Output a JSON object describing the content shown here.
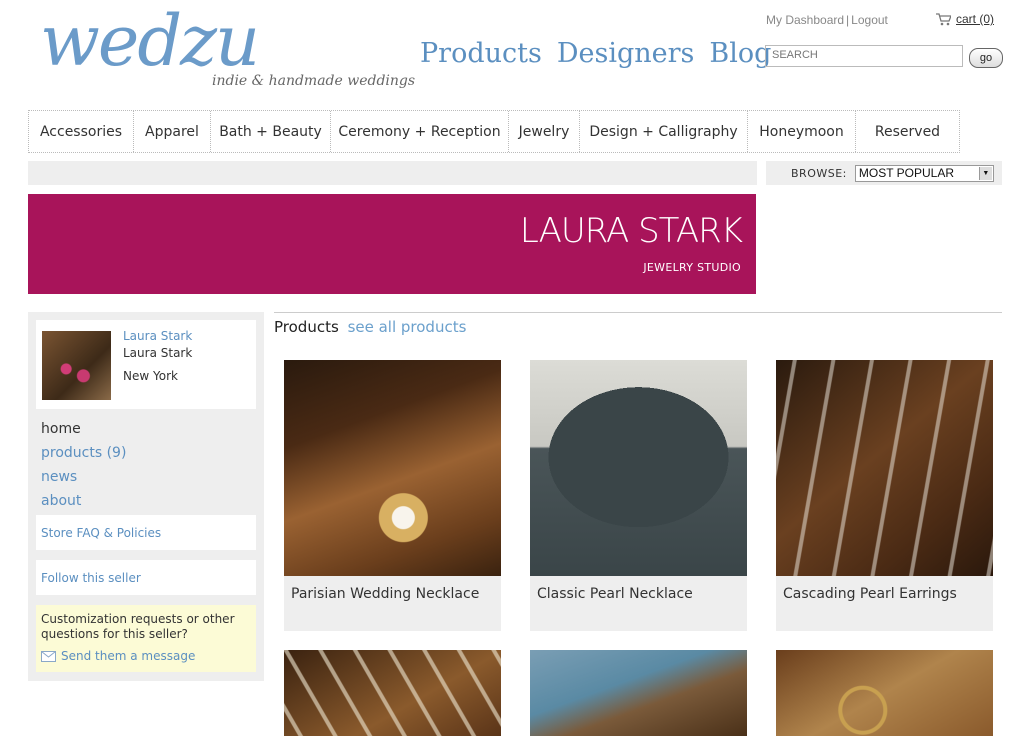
{
  "brand": {
    "logo": "wedzu",
    "tagline": "indie & handmade weddings"
  },
  "main_nav": [
    "Products",
    "Designers",
    "Blog"
  ],
  "user_links": {
    "dashboard": "My Dashboard",
    "separator": "|",
    "logout": "Logout",
    "cart": "cart (0)"
  },
  "search": {
    "placeholder": "SEARCH",
    "go_label": "go"
  },
  "categories": [
    "Accessories",
    "Apparel",
    "Bath + Beauty",
    "Ceremony + Reception",
    "Jewelry",
    "Design + Calligraphy",
    "Honeymoon",
    "Reserved"
  ],
  "browse": {
    "label": "BROWSE:",
    "selected": "MOST POPULAR"
  },
  "banner": {
    "name": "LAURA STARK",
    "subtitle": "JEWELRY STUDIO"
  },
  "profile": {
    "name_link": "Laura Stark",
    "name": "Laura Stark",
    "location": "New York"
  },
  "store_nav": {
    "home": "home",
    "products": "products (9)",
    "news": "news",
    "about": "about"
  },
  "sidebar_links": {
    "faq": "Store FAQ & Policies",
    "follow": "Follow this seller"
  },
  "contact": {
    "text": "Customization requests or other questions for this seller?",
    "link": "Send them a message"
  },
  "products_section": {
    "heading": "Products",
    "see_all": "see all products"
  },
  "products": [
    {
      "title": "Parisian Wedding Necklace"
    },
    {
      "title": "Classic Pearl Necklace"
    },
    {
      "title": "Cascading Pearl Earrings"
    }
  ],
  "colors": {
    "accent_blue": "#5b8fc0",
    "banner": "#a8145a",
    "sidebar_bg": "#eeeeee",
    "note_bg": "#fcfbd6"
  }
}
